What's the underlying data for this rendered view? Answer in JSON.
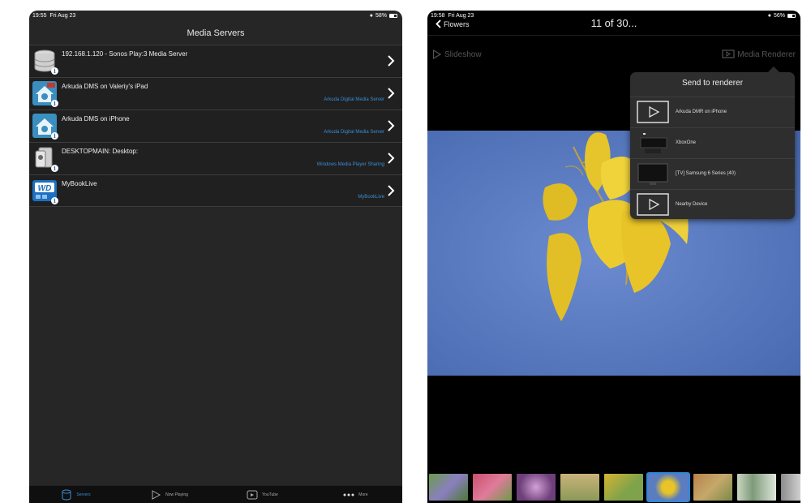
{
  "left": {
    "status": {
      "time": "19:55",
      "date": "Fri Aug 23",
      "battery": "58%"
    },
    "title": "Media Servers",
    "servers": [
      {
        "name": "192.168.1.120 - Sonos Play:3 Media Server",
        "sub": "",
        "icon": "database-icon"
      },
      {
        "name": "Arkuda DMS on Valeriy's iPad",
        "sub": "Arkuda Digital Media Server",
        "icon": "home-media-icon"
      },
      {
        "name": "Arkuda DMS on iPhone",
        "sub": "Arkuda Digital Media Server",
        "icon": "home-media-icon"
      },
      {
        "name": "DESKTOPMAIN: Desktop:",
        "sub": "Windows Media Player Sharing",
        "icon": "windows-media-icon"
      },
      {
        "name": "MyBookLive",
        "sub": "MyBookLive",
        "icon": "wd-drive-icon",
        "icon_text": "WD"
      }
    ],
    "tabs": [
      {
        "label": "Servers",
        "icon": "database-icon",
        "active": true
      },
      {
        "label": "Now Playing",
        "icon": "play-icon",
        "active": false
      },
      {
        "label": "YouTube",
        "icon": "youtube-icon",
        "active": false
      },
      {
        "label": "More",
        "icon": "more-icon",
        "active": false
      }
    ],
    "info_badge": "i"
  },
  "right": {
    "status": {
      "time": "19:58",
      "date": "Fri Aug 23",
      "battery": "56%"
    },
    "back_label": "Flowers",
    "title": "11 of 30...",
    "slideshow_label": "Slideshow",
    "renderer_label": "Media Renderer",
    "popover": {
      "title": "Send to renderer",
      "items": [
        {
          "label": "Arkuda DMR on iPhone",
          "icon": "play-monitor-icon"
        },
        {
          "label": "XboxOne",
          "icon": "xbox-console-icon"
        },
        {
          "label": "[TV] Samsung 6 Series (40)",
          "icon": "tv-icon"
        },
        {
          "label": "Nearby Device",
          "icon": "play-monitor-icon"
        }
      ]
    },
    "thumbnails_selected_index": 5,
    "colors": {
      "accent": "#3a8dd4",
      "sky": "#5a7cc0",
      "leaf": "#e8c428"
    }
  }
}
